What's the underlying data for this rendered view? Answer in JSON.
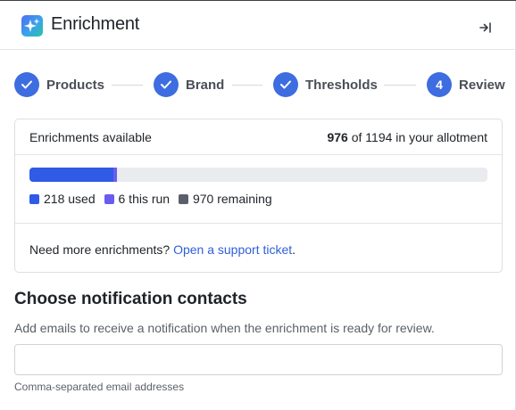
{
  "header": {
    "title": "Enrichment",
    "app_icon": "sparkles-icon",
    "collapse_icon": "collapse-panel-icon"
  },
  "steps": [
    {
      "label": "Products",
      "state": "complete",
      "marker": "check"
    },
    {
      "label": "Brand",
      "state": "complete",
      "marker": "check"
    },
    {
      "label": "Thresholds",
      "state": "complete",
      "marker": "check"
    },
    {
      "label": "Review",
      "state": "current",
      "marker": "4"
    }
  ],
  "allotment": {
    "label": "Enrichments available",
    "available": "976",
    "of_text": "of 1194 in your allotment",
    "total": 1194,
    "legend": [
      {
        "key": "used",
        "value": 218,
        "text": "218 used",
        "color": "#2f5be6"
      },
      {
        "key": "run",
        "value": 6,
        "text": "6 this run",
        "color": "#6a5cf0"
      },
      {
        "key": "remaining",
        "value": 970,
        "text": "970 remaining",
        "color": "#5c5f6b"
      }
    ],
    "bar_colors": {
      "used": "#2f5be6",
      "run": "#6a5cf0",
      "remaining": "#e9ebee"
    }
  },
  "support": {
    "text": "Need more enrichments?",
    "link": "Open a support ticket",
    "suffix": "."
  },
  "notifications": {
    "title": "Choose notification contacts",
    "description": "Add emails to receive a notification when the enrichment is ready for review.",
    "input_value": "",
    "helper": "Comma-separated email addresses"
  }
}
